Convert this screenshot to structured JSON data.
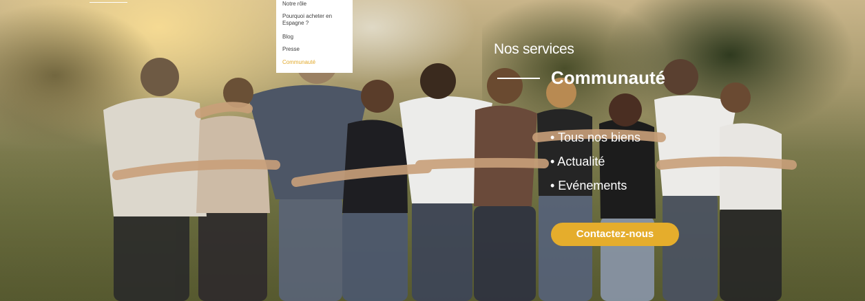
{
  "nav": {
    "submenu": [
      {
        "label": "Notre rôle"
      },
      {
        "label": "Pourquoi acheter en Espagne ?"
      },
      {
        "label": "Blog"
      },
      {
        "label": "Presse"
      },
      {
        "label": "Communauté",
        "active": true
      }
    ]
  },
  "hero": {
    "eyebrow": "Nos services",
    "title": "Communauté",
    "links": [
      "• Tous nos biens",
      "• Actualité",
      "• Evénements"
    ],
    "cta_label": "Contactez-nous",
    "background_image": "group-of-friends-hugging-in-park",
    "colors": {
      "accent": "#e5ad2c",
      "active_menu": "#e2a92b",
      "text": "#ffffff"
    }
  }
}
